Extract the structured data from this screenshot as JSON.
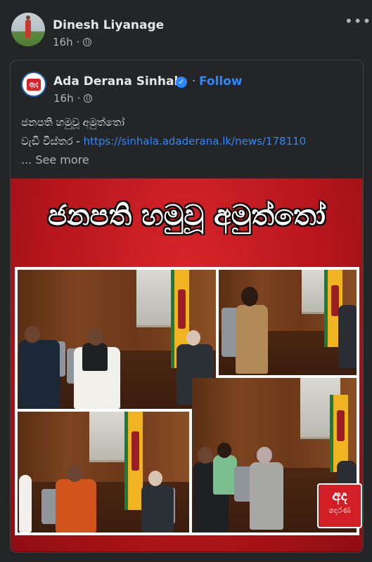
{
  "post": {
    "author": "Dinesh Liyanage",
    "time": "16h",
    "more_icon": "ellipsis-icon"
  },
  "shared": {
    "page_name": "Ada Derana Sinhala",
    "page_logo_text": "ඇද",
    "follow_separator": "·",
    "follow_label": "Follow",
    "time": "16h",
    "caption_line1": "ජනපති හමුවූ අමුත්තෝ",
    "caption_line2_prefix": "වැඩි විස්තර - ",
    "caption_link": "https://sinhala.adaderana.lk/news/178110",
    "see_more": "... See more"
  },
  "image": {
    "headline": "ජනපති හමුවූ අමුත්තෝ",
    "watermark_top": "අද",
    "watermark_bottom": "දෙරණ"
  },
  "colors": {
    "background": "#242526",
    "link": "#2d88ff",
    "brand_red": "#d21f26"
  }
}
